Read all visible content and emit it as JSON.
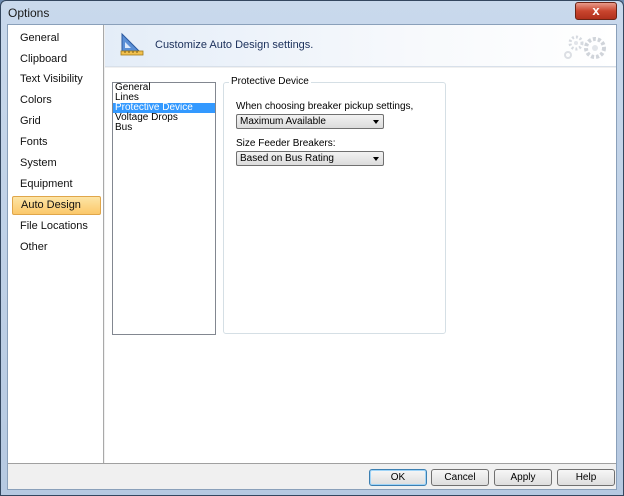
{
  "window": {
    "title": "Options",
    "close_label": "x"
  },
  "nav": {
    "items": [
      {
        "label": "General"
      },
      {
        "label": "Clipboard"
      },
      {
        "label": "Text Visibility"
      },
      {
        "label": "Colors"
      },
      {
        "label": "Grid"
      },
      {
        "label": "Fonts"
      },
      {
        "label": "System"
      },
      {
        "label": "Equipment"
      },
      {
        "label": "Auto Design",
        "selected": true
      },
      {
        "label": "File Locations"
      },
      {
        "label": "Other"
      }
    ]
  },
  "header": {
    "text": "Customize Auto Design settings.",
    "icon": "ruler-triangle-icon"
  },
  "list": {
    "items": [
      "General",
      "Lines",
      "Protective Device",
      "Voltage Drops",
      "Bus"
    ],
    "selected": "Protective Device"
  },
  "group": {
    "title": "Protective Device",
    "field1": {
      "label": "When choosing breaker pickup settings, assume:",
      "value": "Maximum Available"
    },
    "field2": {
      "label": "Size Feeder Breakers:",
      "value": "Based on Bus Rating"
    }
  },
  "footer": {
    "ok": "OK",
    "cancel": "Cancel",
    "apply": "Apply",
    "help": "Help"
  }
}
